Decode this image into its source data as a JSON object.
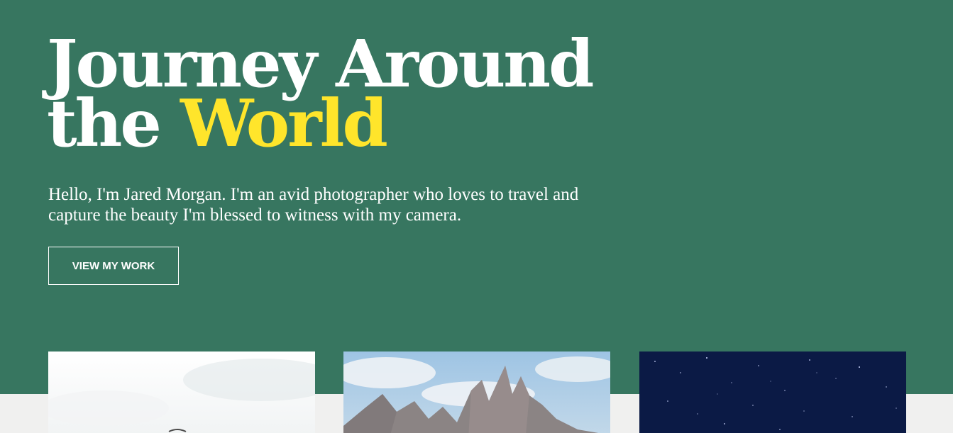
{
  "hero": {
    "title_line1": "Journey Around",
    "title_line2_prefix": "the ",
    "title_line2_accent": "World",
    "intro": "Hello, I'm Jared Morgan. I'm an avid photographer who loves to travel and capture the beauty I'm blessed to witness with my camera.",
    "cta_label": "VIEW MY WORK"
  },
  "gallery": {
    "photos": [
      {
        "name": "misty-landscape-photo"
      },
      {
        "name": "mountain-peaks-photo"
      },
      {
        "name": "starry-night-sky-photo"
      }
    ]
  },
  "colors": {
    "hero_background": "#377660",
    "accent": "#ffe52b",
    "page_background": "#f0f0ef",
    "text": "#ffffff"
  }
}
